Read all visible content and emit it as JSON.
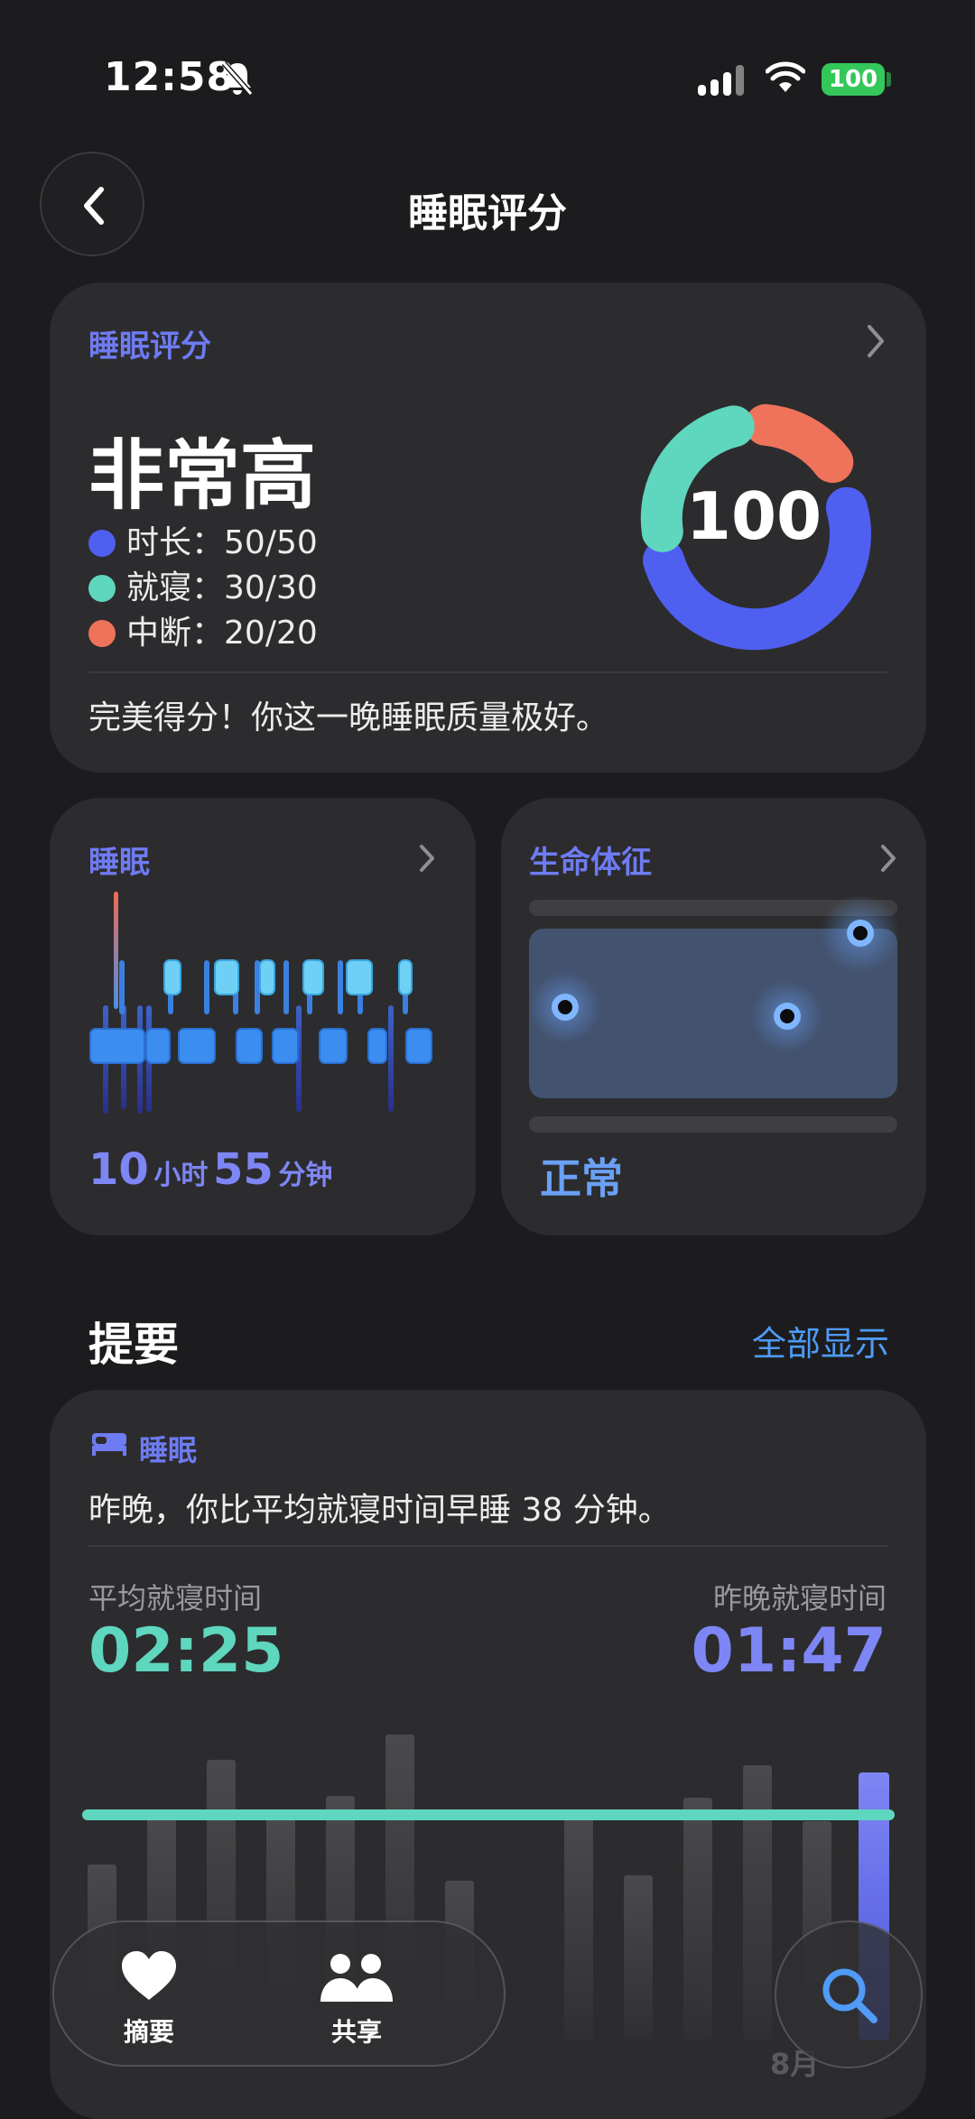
{
  "status_bar": {
    "time": "12:58",
    "battery": "100"
  },
  "header": {
    "title": "睡眠评分"
  },
  "score_card": {
    "label": "睡眠评分",
    "level": "非常高",
    "score": "100",
    "legend": [
      {
        "name": "时长：",
        "value": "50/50",
        "color": "#4f5ff0"
      },
      {
        "name": "就寝：",
        "value": "30/30",
        "color": "#5fd6be"
      },
      {
        "name": "中断：",
        "value": "20/20",
        "color": "#ef735a"
      }
    ],
    "message": "完美得分！你这一晚睡眠质量极好。"
  },
  "sleep_card": {
    "label": "睡眠",
    "hours": "10",
    "hours_unit": "小时",
    "minutes": "55",
    "minutes_unit": "分钟"
  },
  "vitals_card": {
    "label": "生命体征",
    "status": "正常"
  },
  "summary": {
    "title": "提要",
    "show_all": "全部显示",
    "tag": "睡眠",
    "sentence": "昨晚，你比平均就寝时间早睡 38 分钟。",
    "avg_label": "平均就寝时间",
    "avg_value": "02:25",
    "last_label": "昨晚就寝时间",
    "last_value": "01:47",
    "date_label": "8月"
  },
  "tab_bar": {
    "tabs": [
      {
        "label": "摘要"
      },
      {
        "label": "共享"
      }
    ]
  },
  "icons": [
    "bell-slash-icon",
    "cellular-signal-icon",
    "wifi-icon",
    "battery-icon",
    "chevron-left-icon",
    "chevron-right-icon",
    "bed-icon",
    "heart-icon",
    "people-icon",
    "search-icon"
  ]
}
